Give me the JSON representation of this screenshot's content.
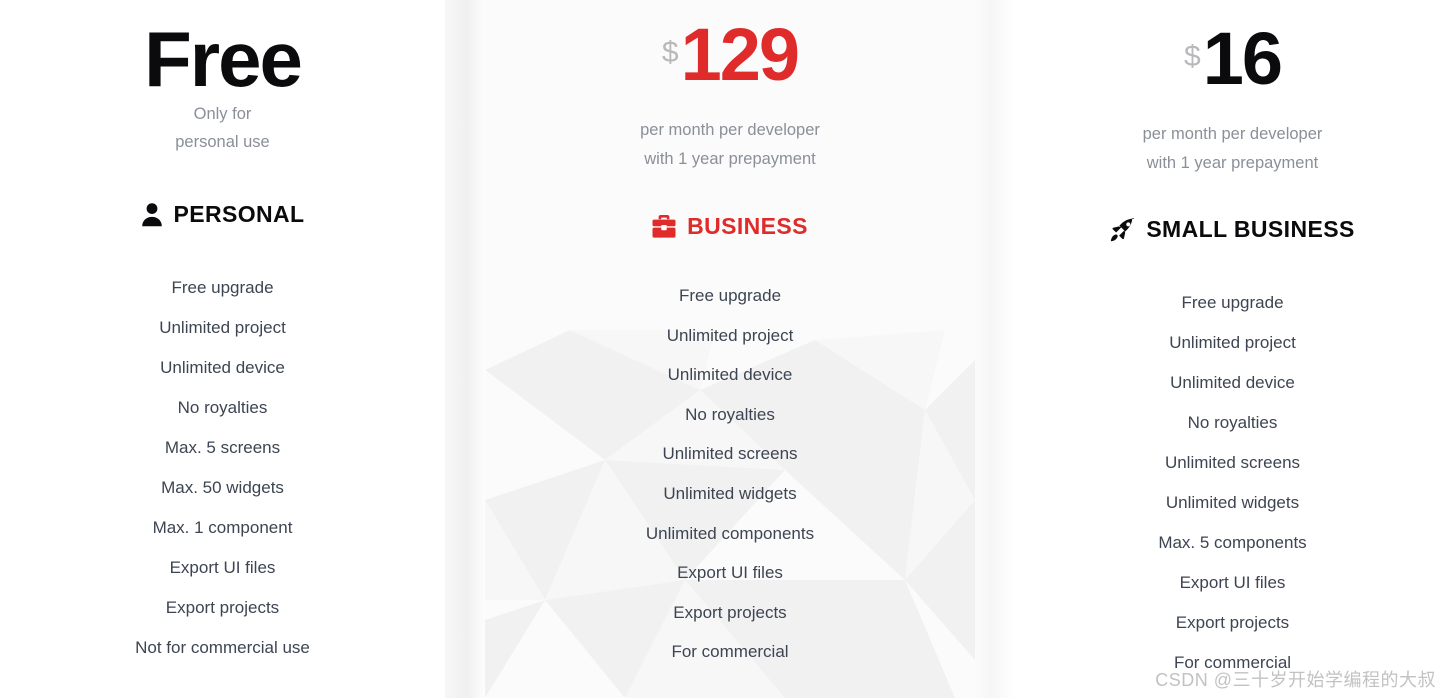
{
  "plans": [
    {
      "id": "personal",
      "price_display": "Free",
      "currency": "",
      "amount": "",
      "notes": [
        "Only for",
        "personal use"
      ],
      "icon": "person-icon",
      "name": "PERSONAL",
      "accent": "#0b0b0d",
      "features": [
        "Free upgrade",
        "Unlimited project",
        "Unlimited device",
        "No royalties",
        "Max. 5 screens",
        "Max. 50 widgets",
        "Max. 1 component",
        "Export UI files",
        "Export projects",
        "Not for commercial use"
      ]
    },
    {
      "id": "business",
      "price_display": "$129",
      "currency": "$",
      "amount": "129",
      "notes": [
        "per month per developer",
        "with 1 year prepayment"
      ],
      "icon": "briefcase-icon",
      "name": "BUSINESS",
      "accent": "#e02b2b",
      "features": [
        "Free upgrade",
        "Unlimited project",
        "Unlimited device",
        "No royalties",
        "Unlimited screens",
        "Unlimited widgets",
        "Unlimited components",
        "Export UI files",
        "Export projects",
        "For commercial"
      ]
    },
    {
      "id": "small-business",
      "price_display": "$16",
      "currency": "$",
      "amount": "16",
      "notes": [
        "per month per developer",
        "with 1 year prepayment"
      ],
      "icon": "rocket-icon",
      "name": "SMALL BUSINESS",
      "accent": "#0b0b0d",
      "features": [
        "Free upgrade",
        "Unlimited project",
        "Unlimited device",
        "No royalties",
        "Unlimited screens",
        "Unlimited widgets",
        "Max. 5 components",
        "Export UI files",
        "Export projects",
        "For commercial"
      ]
    }
  ],
  "watermark": "CSDN @三十岁开始学编程的大叔",
  "colors": {
    "brand_red": "#e02b2b",
    "heading_dark": "#0b0b0d",
    "feature_text": "#3d4552",
    "note_text": "#8a8f98",
    "currency_grey": "#b9b9bb",
    "business_bg": "#fbfbfb",
    "page_bg": "#ffffff"
  }
}
